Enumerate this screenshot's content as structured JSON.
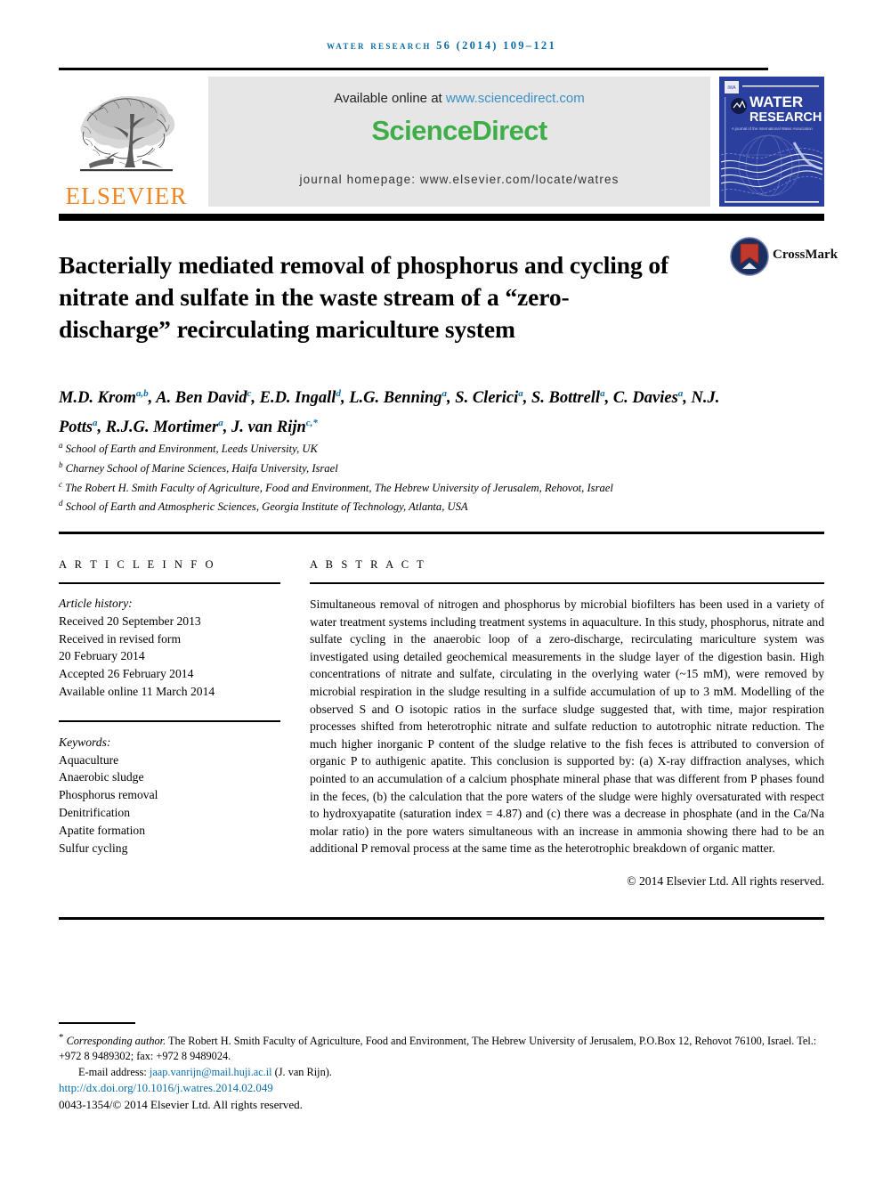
{
  "running_head": "water research 56 (2014) 109–121",
  "banner": {
    "publisher_name": "ELSEVIER",
    "available_prefix": "Available online at ",
    "available_url": "www.sciencedirect.com",
    "sciencedirect_logo": "ScienceDirect",
    "journal_homepage": "journal homepage: www.elsevier.com/locate/watres",
    "cover_title_line1": "WATER",
    "cover_title_line2": "RESEARCH",
    "cover_subtitle": "A journal of the International Water Association",
    "cover_logo_text": "IWA",
    "colors": {
      "link": "#3a8fc4",
      "sciencedirect_green": "#3FAE49",
      "elsevier_orange": "#F08521",
      "cover_blue": "#2b3f9e",
      "running_head_blue": "#0b6ea8"
    }
  },
  "article": {
    "title": "Bacterially mediated removal of phosphorus and cycling of nitrate and sulfate in the waste stream of a “zero-discharge” recirculating mariculture system",
    "crossmark_label": "CrossMark",
    "authors_html": "M.D. Krom<sup>a,b</sup>, A. Ben David<sup>c</sup>, E.D. Ingall<sup>d</sup>, L.G. Benning<sup>a</sup>, S. Clerici<sup>a</sup>, S. Bottrell<sup>a</sup>, C. Davies<sup>a</sup>, N.J. Potts<sup>a</sup>, R.J.G. Mortimer<sup>a</sup>, J. van Rijn<sup>c,*</sup>",
    "affiliations": [
      {
        "marker": "a",
        "text": "School of Earth and Environment, Leeds University, UK"
      },
      {
        "marker": "b",
        "text": "Charney School of Marine Sciences, Haifa University, Israel"
      },
      {
        "marker": "c",
        "text": "The Robert H. Smith Faculty of Agriculture, Food and Environment, The Hebrew University of Jerusalem, Rehovot, Israel"
      },
      {
        "marker": "d",
        "text": "School of Earth and Atmospheric Sciences, Georgia Institute of Technology, Atlanta, USA"
      }
    ]
  },
  "article_info": {
    "heading": "A R T I C L E   I N F O",
    "history_label": "Article history:",
    "history": [
      "Received 20 September 2013",
      "Received in revised form",
      "20 February 2014",
      "Accepted 26 February 2014",
      "Available online 11 March 2014"
    ],
    "keywords_label": "Keywords:",
    "keywords": [
      "Aquaculture",
      "Anaerobic sludge",
      "Phosphorus removal",
      "Denitrification",
      "Apatite formation",
      "Sulfur cycling"
    ]
  },
  "abstract": {
    "heading": "A B S T R A C T",
    "text": "Simultaneous removal of nitrogen and phosphorus by microbial biofilters has been used in a variety of water treatment systems including treatment systems in aquaculture. In this study, phosphorus, nitrate and sulfate cycling in the anaerobic loop of a zero-discharge, recirculating mariculture system was investigated using detailed geochemical measurements in the sludge layer of the digestion basin. High concentrations of nitrate and sulfate, circulating in the overlying water (~15 mM), were removed by microbial respiration in the sludge resulting in a sulfide accumulation of up to 3 mM. Modelling of the observed S and O isotopic ratios in the surface sludge suggested that, with time, major respiration processes shifted from heterotrophic nitrate and sulfate reduction to autotrophic nitrate reduction. The much higher inorganic P content of the sludge relative to the fish feces is attributed to conversion of organic P to authigenic apatite. This conclusion is supported by: (a) X-ray diffraction analyses, which pointed to an accumulation of a calcium phosphate mineral phase that was different from P phases found in the feces, (b) the calculation that the pore waters of the sludge were highly oversaturated with respect to hydroxyapatite (saturation index = 4.87) and (c) there was a decrease in phosphate (and in the Ca/Na molar ratio) in the pore waters simultaneous with an increase in ammonia showing there had to be an additional P removal process at the same time as the heterotrophic breakdown of organic matter.",
    "copyright": "© 2014 Elsevier Ltd. All rights reserved."
  },
  "footnotes": {
    "corresponding_label": "Corresponding author.",
    "corresponding_text": " The Robert H. Smith Faculty of Agriculture, Food and Environment, The Hebrew University of Jerusalem, P.O.Box 12, Rehovot 76100, Israel. Tel.: +972 8 9489302; fax: +972 8 9489024.",
    "email_label": "E-mail address:",
    "email": "jaap.vanrijn@mail.huji.ac.il",
    "email_owner": "(J. van Rijn).",
    "doi": "http://dx.doi.org/10.1016/j.watres.2014.02.049",
    "issn_line": "0043-1354/© 2014 Elsevier Ltd. All rights reserved."
  }
}
